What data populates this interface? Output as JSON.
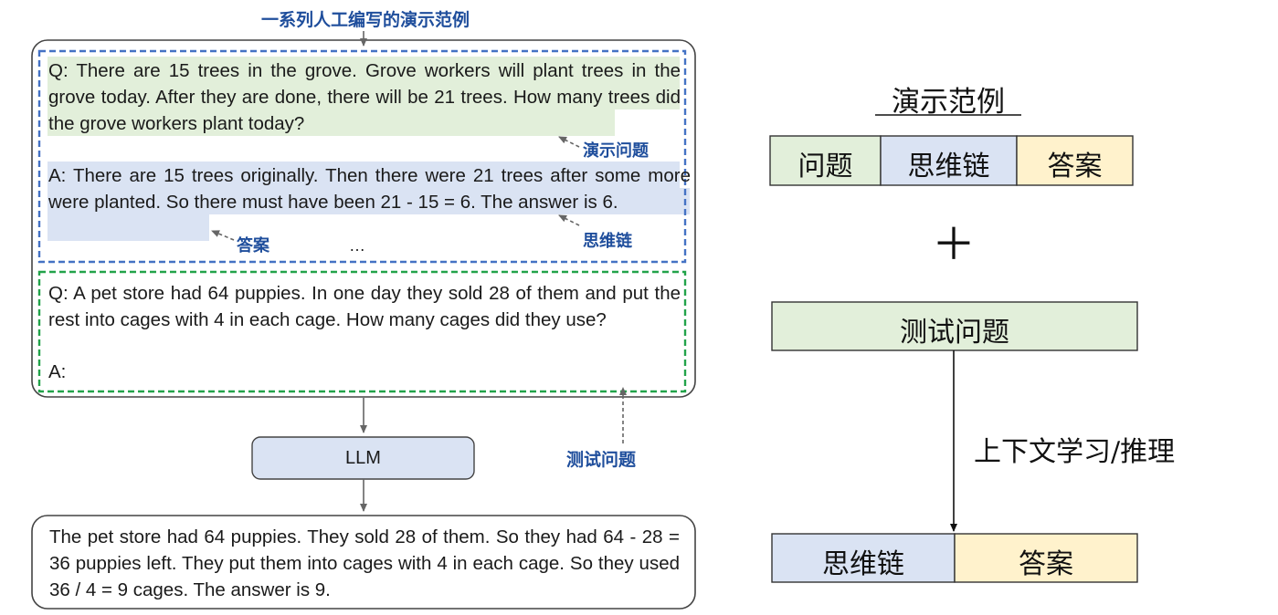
{
  "left": {
    "title": "一系列人工编写的演示范例",
    "demo_question": "Q: There are 15 trees in the grove. Grove workers will plant trees in the grove today. After they are done, there will be 21 trees. How many trees did the grove workers plant today?",
    "demo_question_label": "演示问题",
    "demo_answer": "A: There are 15 trees originally. Then there were 21 trees after some more were planted. So there must have been 21 - 15 = 6. The answer is 6.",
    "answer_label": "答案",
    "ellipsis": "…",
    "cot_label": "思维链",
    "test_question": "Q: A pet store had 64 puppies. In one day they sold 28 of them and put the rest into cages with 4 in each cage. How many cages did they use?",
    "test_answer_prompt": "A:",
    "llm": "LLM",
    "test_question_label": "测试问题",
    "output": "The pet store had 64 puppies. They sold 28 of them. So they had 64 - 28 = 36 puppies left. They put them into cages with 4 in each cage. So they used 36 / 4 = 9 cages. The answer is 9."
  },
  "right": {
    "title": "演示范例",
    "demo_cells": [
      "问题",
      "思维链",
      "答案"
    ],
    "plus": "＋",
    "test_box": "测试问题",
    "arrow_label": "上下文学习/推理",
    "out_cells": [
      "思维链",
      "答案"
    ]
  },
  "colors": {
    "green": "#e2efda",
    "blue": "#dae3f3",
    "yellow": "#fff2cc",
    "label_blue": "#1f4e9c",
    "dash_blue": "#4472c4",
    "dash_green": "#22a34a"
  }
}
